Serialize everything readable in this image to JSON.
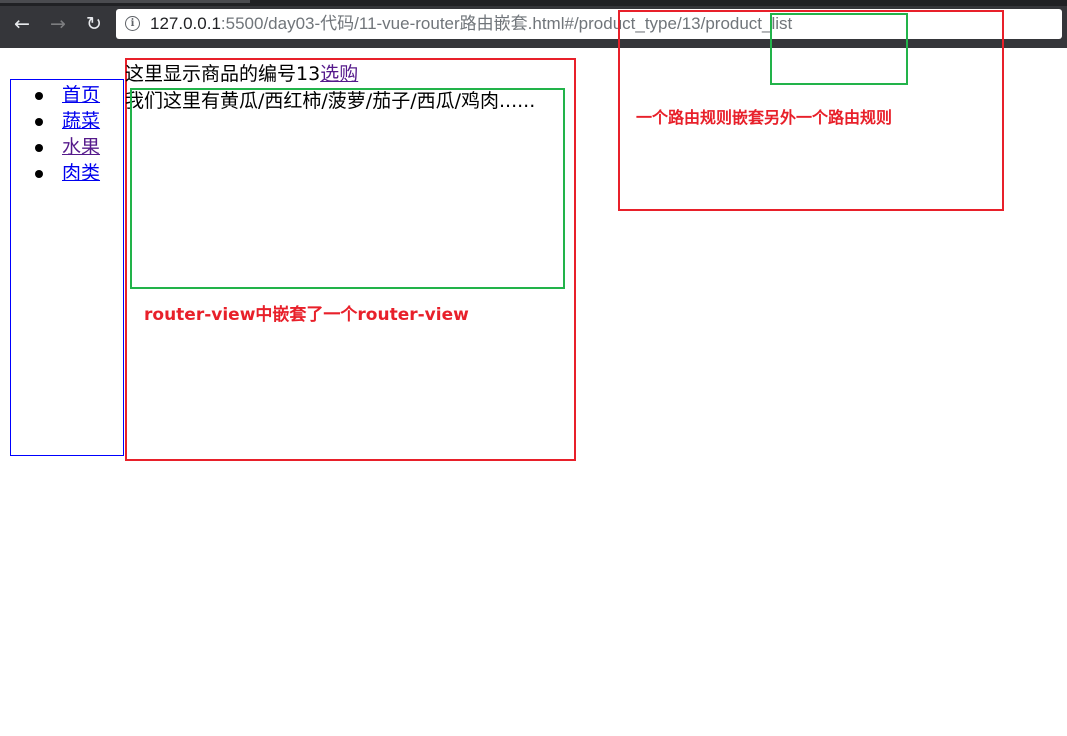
{
  "browser": {
    "back_icon": "arrow-left-icon",
    "forward_icon": "arrow-right-icon",
    "reload_icon": "reload-icon",
    "info_icon": "info-icon",
    "url_host": "127.0.0.1",
    "url_rest": ":5500/day03-代码/11-vue-router路由嵌套.html#/product_type/13/product_list"
  },
  "nav": {
    "items": [
      {
        "label": "首页"
      },
      {
        "label": "蔬菜"
      },
      {
        "label": "水果"
      },
      {
        "label": "肉类"
      }
    ]
  },
  "product": {
    "id_text": "这里显示商品的编号13",
    "buy_link": "选购",
    "list_text": "我们这里有黄瓜/西红柿/菠萝/茄子/西瓜/鸡肉......"
  },
  "annotations": {
    "router_view_note": "router-view中嵌套了一个router-view",
    "nested_rule_note": "一个路由规则嵌套另外一个路由规则",
    "colors": {
      "red": "#e8202a",
      "green": "#22b34a",
      "blue": "#0000ff"
    }
  }
}
